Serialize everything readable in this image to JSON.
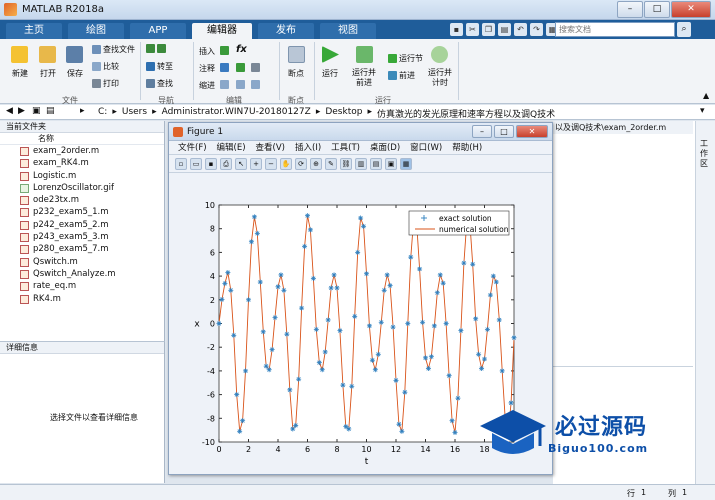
{
  "window": {
    "title": "MATLAB R2018a",
    "min": "–",
    "max": "□",
    "close": "✕"
  },
  "tabs": [
    {
      "label": "主页",
      "active": false
    },
    {
      "label": "绘图",
      "active": false
    },
    {
      "label": "APP",
      "active": false
    },
    {
      "label": "编辑器",
      "active": true
    },
    {
      "label": "发布",
      "active": false
    },
    {
      "label": "视图",
      "active": false
    }
  ],
  "search": {
    "placeholder": "搜索文档"
  },
  "ribbon": {
    "file_group": {
      "new": "新建",
      "open": "打开",
      "save": "保存",
      "find_files": "查找文件",
      "compare": "比较",
      "print": "打印",
      "label": "文件"
    },
    "nav_group": {
      "goto": "转至",
      "find": "查找",
      "label": "导航"
    },
    "edit_group": {
      "insert": "插入",
      "comment": "注释",
      "indent": "缩进",
      "fx": "fx",
      "label": "编辑"
    },
    "breakpoint_group": {
      "breakpoints": "断点",
      "label": "断点"
    },
    "run_group": {
      "run": "运行",
      "run_advance": "运行并\n前进",
      "run_section": "运行节",
      "advance": "前进",
      "run_time": "运行并\n计时",
      "label": "运行"
    }
  },
  "path": {
    "crumbs": [
      "C:",
      "Users",
      "Administrator.WIN7U-20180127Z",
      "Desktop",
      "仿真激光的发光原理和速率方程以及调Q技术"
    ]
  },
  "current_folder": {
    "title": "当前文件夹",
    "column": "名称",
    "files": [
      {
        "name": "exam_2order.m",
        "type": "m"
      },
      {
        "name": "exam_RK4.m",
        "type": "m"
      },
      {
        "name": "Logistic.m",
        "type": "m"
      },
      {
        "name": "LorenzOscillator.gif",
        "type": "gif"
      },
      {
        "name": "ode23tx.m",
        "type": "m"
      },
      {
        "name": "p232_exam5_1.m",
        "type": "m"
      },
      {
        "name": "p242_exam5_2.m",
        "type": "m"
      },
      {
        "name": "p243_exam5_3.m",
        "type": "m"
      },
      {
        "name": "p280_exam5_7.m",
        "type": "m"
      },
      {
        "name": "Qswitch.m",
        "type": "m"
      },
      {
        "name": "Qswitch_Analyze.m",
        "type": "m"
      },
      {
        "name": "rate_eq.m",
        "type": "m"
      },
      {
        "name": "RK4.m",
        "type": "m"
      }
    ]
  },
  "details": {
    "title": "详细信息",
    "placeholder": "选择文件以查看详细信息"
  },
  "editor_tab": {
    "path_text": "以及调Q技术\\exam_2order.m"
  },
  "workspace_side": {
    "label": "工作区"
  },
  "status": {
    "row_label": "行",
    "row": "1",
    "col_label": "列",
    "col": "1"
  },
  "figure": {
    "title": "Figure 1",
    "menu": [
      "文件(F)",
      "编辑(E)",
      "查看(V)",
      "插入(I)",
      "工具(T)",
      "桌面(D)",
      "窗口(W)",
      "帮助(H)"
    ],
    "tools": [
      "new-icon",
      "open-icon",
      "save-icon",
      "print-icon",
      "pointer-icon",
      "zoom-in-icon",
      "zoom-out-icon",
      "pan-icon",
      "rotate-icon",
      "data-cursor-icon",
      "brush-icon",
      "link-icon",
      "colorbar-icon",
      "legend-icon",
      "hide-plot-tools-icon",
      "show-plot-tools-icon"
    ]
  },
  "chart_data": {
    "type": "line",
    "xlabel": "t",
    "ylabel": "x",
    "xlim": [
      0,
      20
    ],
    "ylim": [
      -10,
      10
    ],
    "xticks": [
      0,
      2,
      4,
      6,
      8,
      10,
      12,
      14,
      16,
      18,
      20
    ],
    "yticks": [
      -10,
      -8,
      -6,
      -4,
      -2,
      0,
      2,
      4,
      6,
      8,
      10
    ],
    "legend": "top-right",
    "series": [
      {
        "name": "exact solution",
        "style": "markers",
        "color": "#2e7fbf"
      },
      {
        "name": "numerical solution",
        "style": "line",
        "color": "#d95319"
      }
    ],
    "x": [
      0.0,
      0.2,
      0.4,
      0.6,
      0.8,
      1.0,
      1.2,
      1.4,
      1.6,
      1.8,
      2.0,
      2.2,
      2.4,
      2.6,
      2.8,
      3.0,
      3.2,
      3.4,
      3.6,
      3.8,
      4.0,
      4.2,
      4.4,
      4.6,
      4.8,
      5.0,
      5.2,
      5.4,
      5.6,
      5.8,
      6.0,
      6.2,
      6.4,
      6.6,
      6.8,
      7.0,
      7.2,
      7.4,
      7.6,
      7.8,
      8.0,
      8.2,
      8.4,
      8.6,
      8.8,
      9.0,
      9.2,
      9.4,
      9.6,
      9.8,
      10.0,
      10.2,
      10.4,
      10.6,
      10.8,
      11.0,
      11.2,
      11.4,
      11.6,
      11.8,
      12.0,
      12.2,
      12.4,
      12.6,
      12.8,
      13.0,
      13.2,
      13.4,
      13.6,
      13.8,
      14.0,
      14.2,
      14.4,
      14.6,
      14.8,
      15.0,
      15.2,
      15.4,
      15.6,
      15.8,
      16.0,
      16.2,
      16.4,
      16.6,
      16.8,
      17.0,
      17.2,
      17.4,
      17.6,
      17.8,
      18.0,
      18.2,
      18.4,
      18.6,
      18.8,
      19.0,
      19.2,
      19.4,
      19.6,
      19.8,
      20.0
    ],
    "y": [
      0.0,
      2.03,
      3.38,
      4.3,
      2.8,
      -1.0,
      -6.0,
      -9.1,
      -8.2,
      -4.0,
      2.0,
      6.9,
      9.0,
      7.6,
      3.5,
      -0.7,
      -3.6,
      -3.9,
      -2.2,
      0.5,
      3.1,
      4.1,
      2.8,
      -0.9,
      -5.6,
      -8.9,
      -8.6,
      -4.7,
      1.3,
      6.5,
      9.1,
      7.9,
      3.8,
      -0.5,
      -3.3,
      -3.9,
      -2.4,
      0.3,
      3.0,
      4.1,
      3.0,
      -0.6,
      -5.2,
      -8.7,
      -8.9,
      -5.3,
      0.6,
      6.0,
      8.9,
      8.2,
      4.2,
      -0.2,
      -3.1,
      -3.9,
      -2.6,
      0.1,
      2.8,
      4.1,
      3.2,
      -0.3,
      -4.8,
      -8.5,
      -9.1,
      -5.8,
      0.0,
      5.6,
      8.8,
      8.4,
      4.6,
      0.1,
      -2.9,
      -3.8,
      -2.8,
      -0.2,
      2.6,
      4.1,
      3.4,
      0.0,
      -4.4,
      -8.2,
      -9.2,
      -6.3,
      -0.6,
      5.1,
      8.6,
      8.6,
      5.0,
      0.4,
      -2.6,
      -3.8,
      -3.0,
      -0.5,
      2.4,
      4.0,
      3.5,
      0.3,
      -4.0,
      -7.9,
      -9.3,
      -6.7,
      -1.2
    ]
  },
  "watermark": {
    "text": "必过源码",
    "url": "Biguo100.com"
  }
}
